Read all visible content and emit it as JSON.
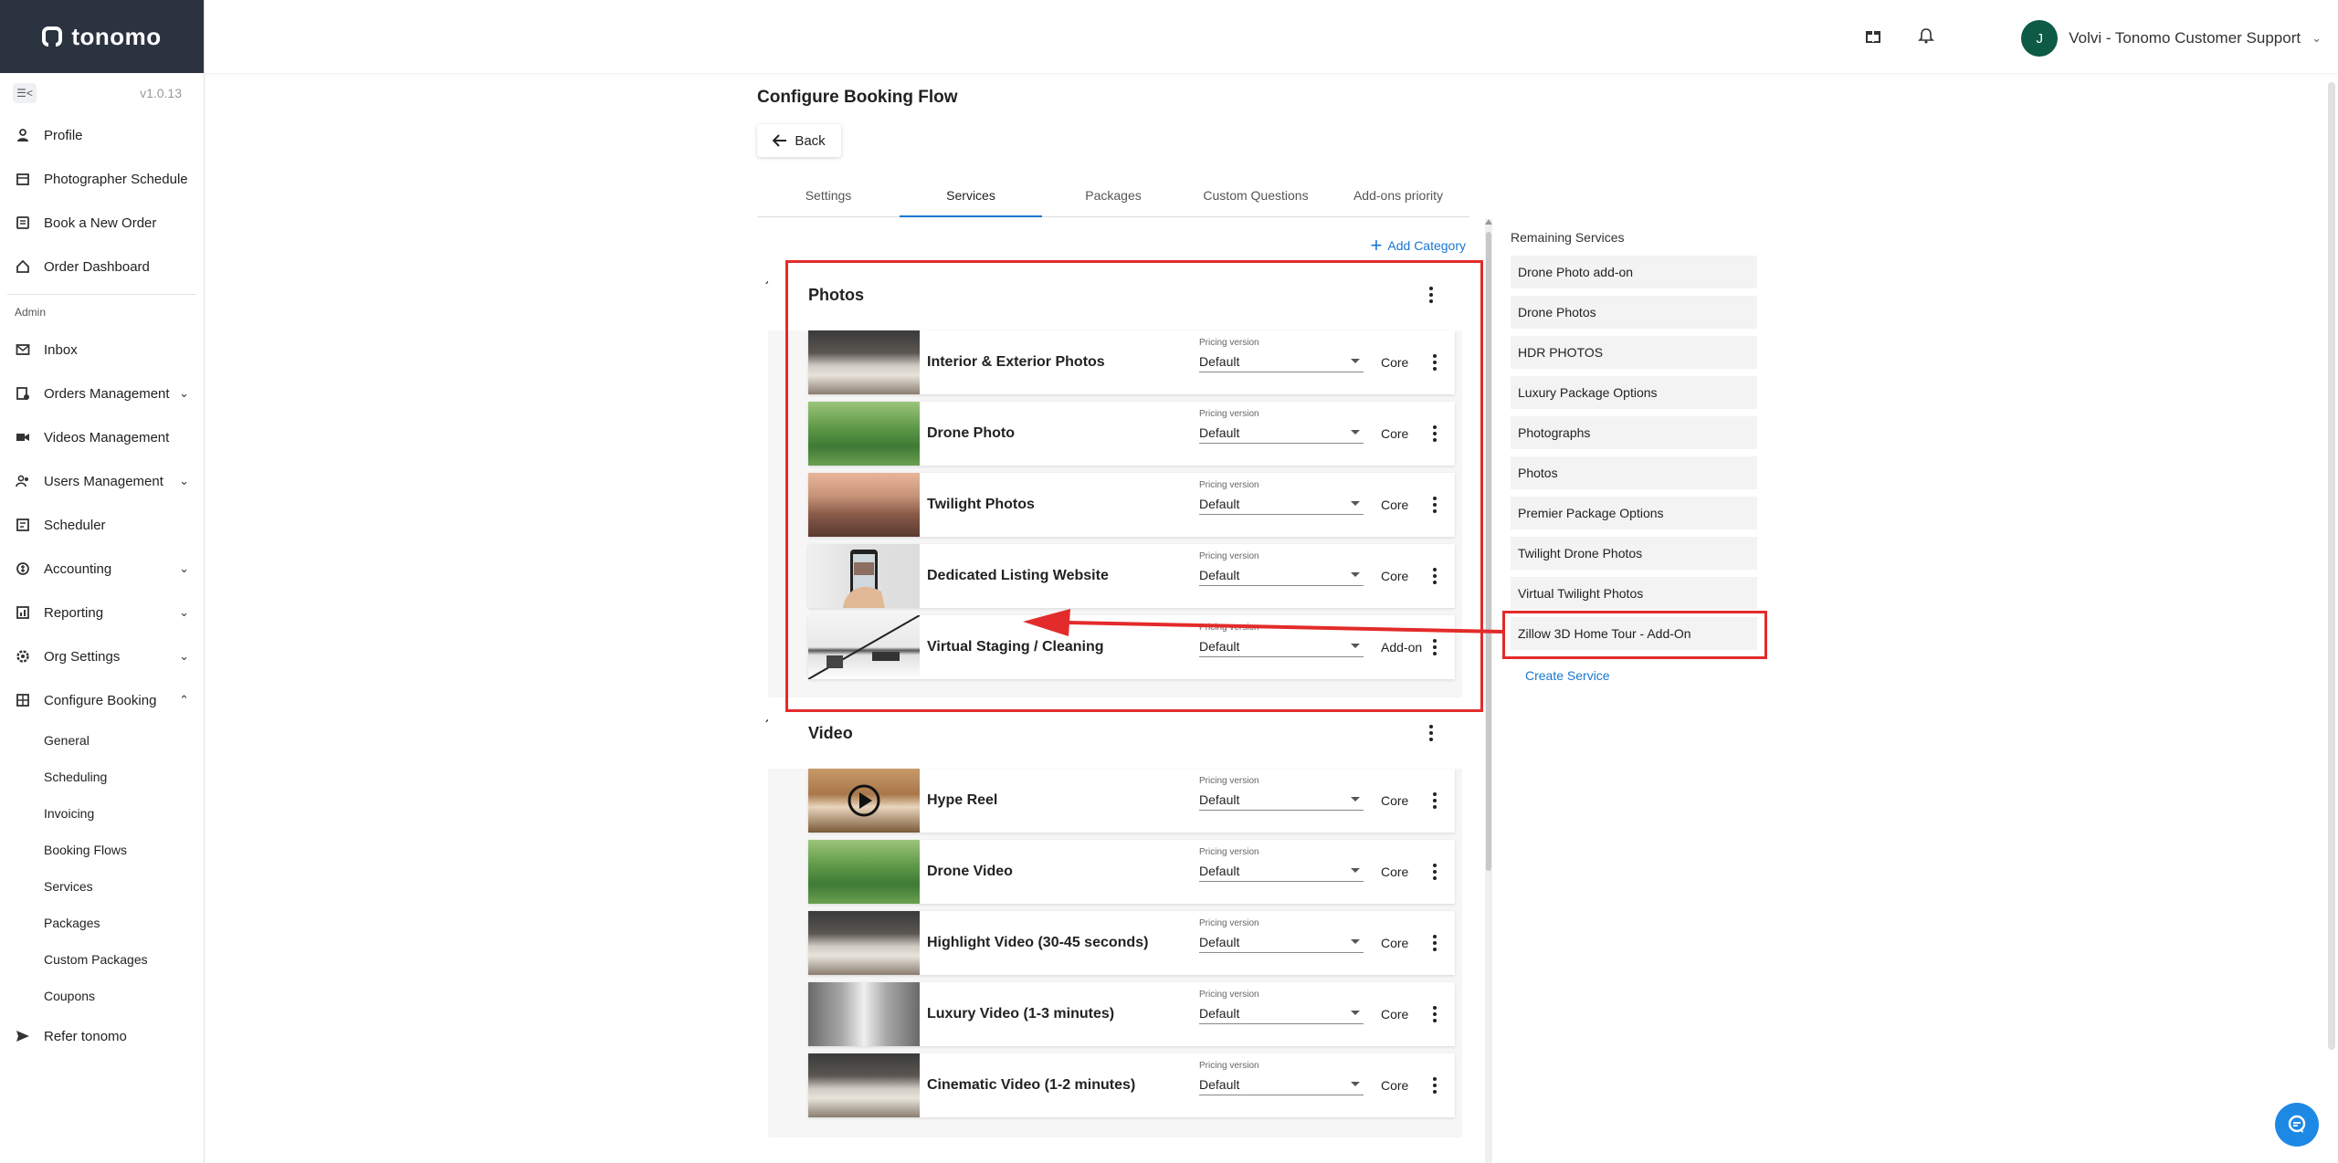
{
  "app": {
    "logo_text": "tonomo",
    "version": "v1.0.13"
  },
  "sidebar": {
    "items_top": [
      {
        "label": "Profile",
        "icon": "person-icon"
      },
      {
        "label": "Photographer Schedule",
        "icon": "calendar-icon"
      },
      {
        "label": "Book a New Order",
        "icon": "book-icon"
      },
      {
        "label": "Order Dashboard",
        "icon": "home-icon"
      }
    ],
    "section_label": "Admin",
    "items_admin": [
      {
        "label": "Inbox",
        "icon": "mail-icon",
        "expandable": false
      },
      {
        "label": "Orders Management",
        "icon": "orders-icon",
        "expandable": true
      },
      {
        "label": "Videos Management",
        "icon": "video-icon",
        "expandable": false
      },
      {
        "label": "Users Management",
        "icon": "users-icon",
        "expandable": true
      },
      {
        "label": "Scheduler",
        "icon": "scheduler-icon",
        "expandable": false
      },
      {
        "label": "Accounting",
        "icon": "accounting-icon",
        "expandable": true
      },
      {
        "label": "Reporting",
        "icon": "reporting-icon",
        "expandable": true
      },
      {
        "label": "Org Settings",
        "icon": "gear-icon",
        "expandable": true
      },
      {
        "label": "Configure Booking",
        "icon": "configure-icon",
        "expandable": true,
        "expanded": true
      }
    ],
    "configure_sub": [
      "General",
      "Scheduling",
      "Invoicing",
      "Booking Flows",
      "Services",
      "Packages",
      "Custom Packages",
      "Coupons"
    ],
    "refer_label": "Refer tonomo"
  },
  "topbar": {
    "user_initial": "J",
    "user_name": "Volvi - Tonomo Customer Support"
  },
  "page": {
    "title": "Configure Booking Flow",
    "back_label": "Back",
    "tabs": [
      "Settings",
      "Services",
      "Packages",
      "Custom Questions",
      "Add-ons priority"
    ],
    "active_tab": "Services",
    "add_category_label": "Add Category"
  },
  "pricing_label": "Pricing version",
  "categories": [
    {
      "name": "Photos",
      "services": [
        {
          "name": "Interior & Exterior Photos",
          "pricing": "Default",
          "type": "Core",
          "thumb": "kitchen"
        },
        {
          "name": "Drone Photo",
          "pricing": "Default",
          "type": "Core",
          "thumb": "aerial"
        },
        {
          "name": "Twilight Photos",
          "pricing": "Default",
          "type": "Core",
          "thumb": "twilight"
        },
        {
          "name": "Dedicated Listing Website",
          "pricing": "Default",
          "type": "Core",
          "thumb": "phone"
        },
        {
          "name": "Virtual Staging / Cleaning",
          "pricing": "Default",
          "type": "Add-on",
          "thumb": "staging"
        }
      ]
    },
    {
      "name": "Video",
      "services": [
        {
          "name": "Hype Reel",
          "pricing": "Default",
          "type": "Core",
          "thumb": "kitchen-play"
        },
        {
          "name": "Drone Video",
          "pricing": "Default",
          "type": "Core",
          "thumb": "aerial"
        },
        {
          "name": "Highlight Video (30-45 seconds)",
          "pricing": "Default",
          "type": "Core",
          "thumb": "kitchen"
        },
        {
          "name": "Luxury Video (1-3 minutes)",
          "pricing": "Default",
          "type": "Core",
          "thumb": "room"
        },
        {
          "name": "Cinematic Video (1-2 minutes)",
          "pricing": "Default",
          "type": "Core",
          "thumb": "kitchen"
        }
      ]
    }
  ],
  "remaining": {
    "title": "Remaining Services",
    "items": [
      "Drone Photo add-on",
      "Drone Photos",
      "HDR PHOTOS",
      "Luxury Package Options",
      "Photographs",
      "Photos",
      "Premier Package Options",
      "Twilight Drone Photos",
      "Virtual Twilight Photos",
      "Zillow 3D Home Tour - Add-On"
    ],
    "create_label": "Create Service"
  },
  "colors": {
    "accent": "#1976d2",
    "highlight": "#e32b2b",
    "logo_bg": "#2b3240",
    "avatar_bg": "#0d5a45"
  }
}
